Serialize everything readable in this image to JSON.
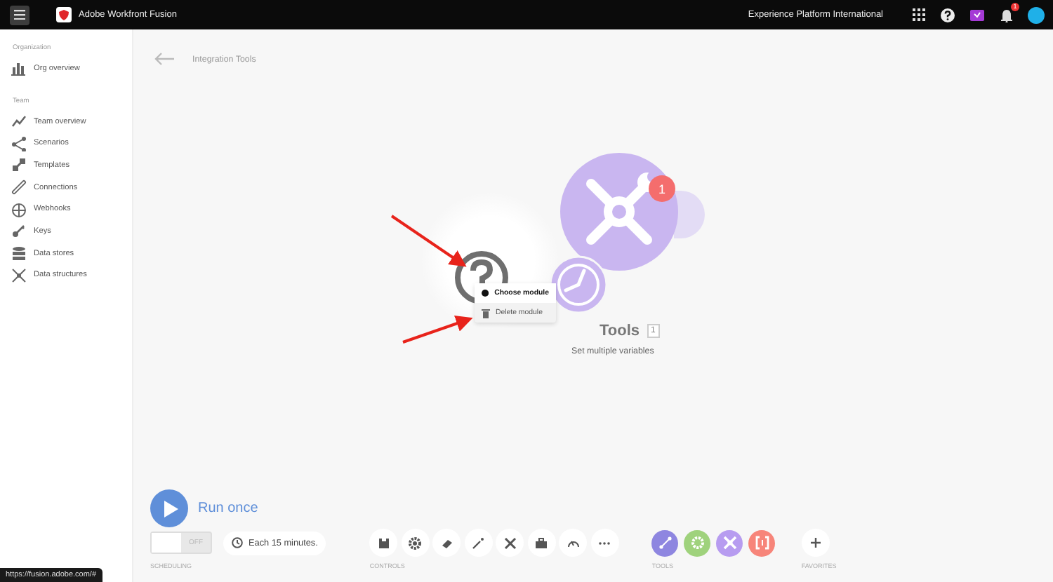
{
  "topbar": {
    "app_name": "Adobe Workfront Fusion",
    "org": "Experience Platform International",
    "notification_count": "1"
  },
  "sidebar": {
    "sections": [
      {
        "heading": "Organization",
        "items": [
          {
            "label": "Org overview",
            "kind": "chart"
          }
        ]
      },
      {
        "heading": "Team",
        "items": [
          {
            "label": "Team overview",
            "kind": "trend"
          },
          {
            "label": "Scenarios",
            "kind": "share"
          },
          {
            "label": "Templates",
            "kind": "puzzle"
          },
          {
            "label": "Connections",
            "kind": "link"
          },
          {
            "label": "Webhooks",
            "kind": "globe"
          },
          {
            "label": "Keys",
            "kind": "key"
          },
          {
            "label": "Data stores",
            "kind": "db"
          },
          {
            "label": "Data structures",
            "kind": "struct"
          }
        ]
      }
    ]
  },
  "scenario": {
    "title": "Integration Tools"
  },
  "modules": [
    {
      "kind": "empty"
    },
    {
      "kind": "tools",
      "name": "Tools",
      "number": "1",
      "subtitle": "Set multiple variables",
      "badge": "1"
    }
  ],
  "context_menu": [
    {
      "label": "Choose module",
      "kind": "choose"
    },
    {
      "label": "Delete module",
      "kind": "delete"
    }
  ],
  "run": {
    "label": "Run once"
  },
  "scheduling": {
    "on": false,
    "state_text": "OFF",
    "interval": "Each 15 minutes.",
    "caption": "SCHEDULING"
  },
  "controls": {
    "caption": "CONTROLS",
    "buttons": [
      {
        "kind": "save"
      },
      {
        "kind": "gear"
      },
      {
        "kind": "eraser"
      },
      {
        "kind": "wand"
      },
      {
        "kind": "plane"
      },
      {
        "kind": "briefcase"
      },
      {
        "kind": "gauge"
      },
      {
        "kind": "more"
      }
    ]
  },
  "tools": {
    "caption": "TOOLS",
    "items": [
      {
        "kind": "flow",
        "color": "#8e86e0"
      },
      {
        "kind": "gear",
        "color": "#9fd27c"
      },
      {
        "kind": "tools",
        "color": "#b79cf0"
      },
      {
        "kind": "bracket",
        "color": "#f7857a"
      }
    ]
  },
  "favorites": {
    "caption": "FAVORITES"
  },
  "status_url": "https://fusion.adobe.com/#"
}
